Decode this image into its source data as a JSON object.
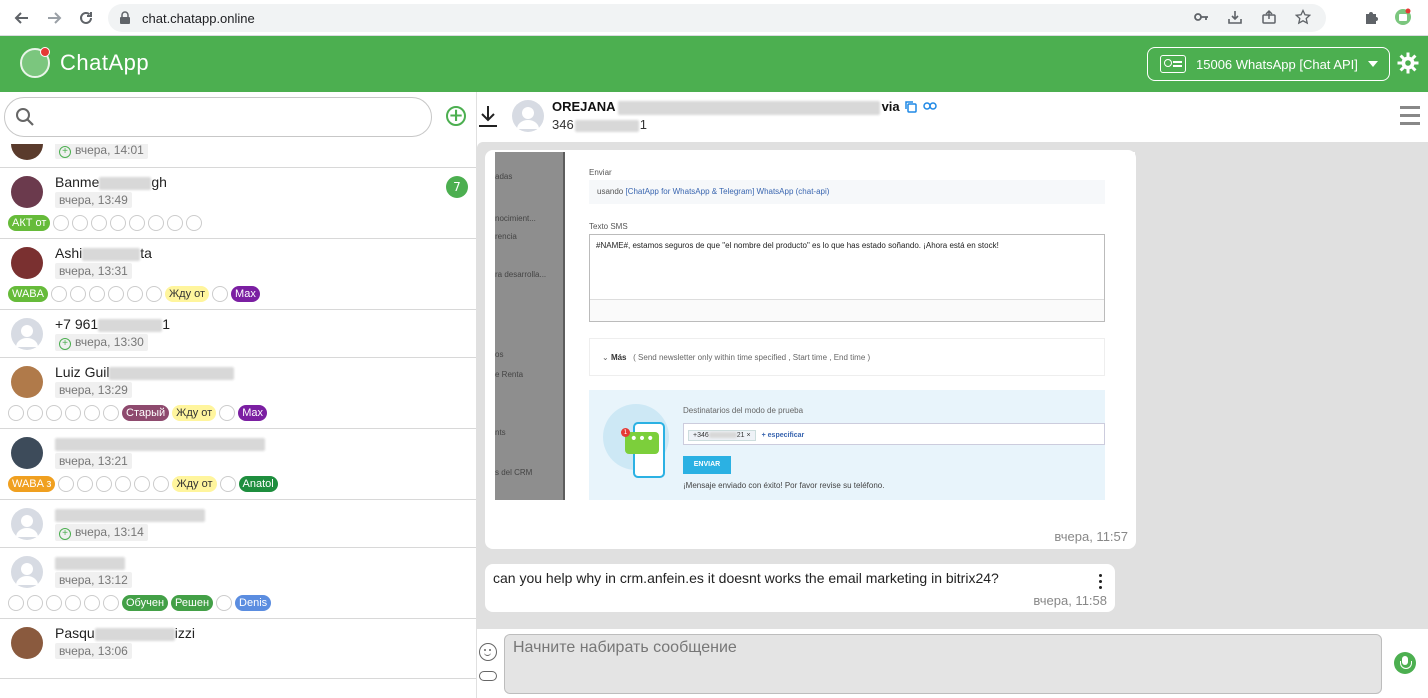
{
  "browser": {
    "url": "chat.chatapp.online",
    "icons": [
      "back-icon",
      "forward-icon",
      "reload-icon",
      "lock-icon",
      "key-icon",
      "install-icon",
      "share-icon",
      "star-icon",
      "extensions-icon",
      "profile-icon"
    ]
  },
  "header": {
    "app_title": "ChatApp",
    "channel_label": "15006 WhatsApp [Chat API]",
    "brand_color": "#4caf50"
  },
  "sidebar": {
    "search_placeholder": "",
    "contacts": [
      {
        "name": "",
        "time": "вчера, 14:01",
        "plus": true,
        "tags": []
      },
      {
        "name": "Banme",
        "name_tail": "gh",
        "time": "вчера, 13:49",
        "unread": "7",
        "tags": [
          {
            "label": "АКТ от",
            "color": "#66bb3a",
            "text": "#fff"
          }
        ]
      },
      {
        "name": "Ashi",
        "name_tail": "ta",
        "time": "вчера, 13:31",
        "tags": [
          {
            "label": "WABA",
            "color": "#66bb3a",
            "text": "#fff"
          },
          {
            "label": "Жду от",
            "color": "#fff59d",
            "text": "#333"
          },
          {
            "label": "Max",
            "color": "#7b1fa2",
            "text": "#fff"
          }
        ]
      },
      {
        "name": "+7 961",
        "name_tail": "1",
        "time": "вчера, 13:30",
        "plus": true,
        "tags": []
      },
      {
        "name": "Luiz Guil",
        "name_tail": "",
        "time": "вчера, 13:29",
        "tags": [
          {
            "label": "Старый",
            "color": "#8e4a6e",
            "text": "#fff"
          },
          {
            "label": "Жду от",
            "color": "#fff59d",
            "text": "#333"
          },
          {
            "label": "Max",
            "color": "#7b1fa2",
            "text": "#fff"
          }
        ]
      },
      {
        "name": "",
        "name_tail": "",
        "time": "вчера, 13:21",
        "tags": [
          {
            "label": "WABA з",
            "color": "#f0a020",
            "text": "#fff"
          },
          {
            "label": "Жду от",
            "color": "#fff59d",
            "text": "#333"
          },
          {
            "label": "Anatol",
            "color": "#1e8e3e",
            "text": "#fff"
          }
        ]
      },
      {
        "name": "",
        "name_tail": "",
        "time": "вчера, 13:14",
        "plus": true,
        "tags": []
      },
      {
        "name": "",
        "name_tail": "",
        "time": "вчера, 13:12",
        "tags": [
          {
            "label": "Обучен",
            "color": "#43a047",
            "text": "#fff"
          },
          {
            "label": "Решен",
            "color": "#43a047",
            "text": "#fff"
          },
          {
            "label": "Denis",
            "color": "#5b8de0",
            "text": "#fff"
          }
        ]
      },
      {
        "name": "Pasqu",
        "name_tail": "izzi",
        "time": "вчера, 13:06",
        "tags": []
      }
    ]
  },
  "chat": {
    "contact_name_start": "OREJANA",
    "contact_name_end": "via",
    "contact_phone_start": "346",
    "contact_phone_end": "1",
    "messages": [
      {
        "type": "image",
        "time": "вчера, 11:57",
        "screenshot": {
          "side_labels": [
            "adas",
            "nocimient...",
            "rencia",
            "ra desarrolla...",
            "os",
            "e Renta",
            "nts",
            "s del CRM"
          ],
          "enviar_label": "Enviar",
          "using_prefix": "usando",
          "using_link": "[ChatApp for WhatsApp & Telegram] WhatsApp (chat-api)",
          "texto_label": "Texto SMS",
          "texto_value": "#NAME#, estamos seguros de que \"el nombre del producto\" es lo que has estado soñando. ¡Ahora está en stock!",
          "mas_label": "Más",
          "mas_hint": "( Send newsletter only within time specified ,  Start time ,  End time )",
          "test_label": "Destinatarios del modo de prueba",
          "test_chip_start": "+346",
          "test_chip_end": "21",
          "especificar": "+ especificar",
          "enviar_btn": "ENVIAR",
          "ok_text": "¡Mensaje enviado con éxito! Por favor revise su teléfono."
        }
      },
      {
        "type": "text",
        "text": "can you help why in crm.anfein.es it doesnt works the email marketing in bitrix24?",
        "time": "вчера, 11:58"
      }
    ]
  },
  "composer": {
    "placeholder": "Начните набирать сообщение"
  }
}
